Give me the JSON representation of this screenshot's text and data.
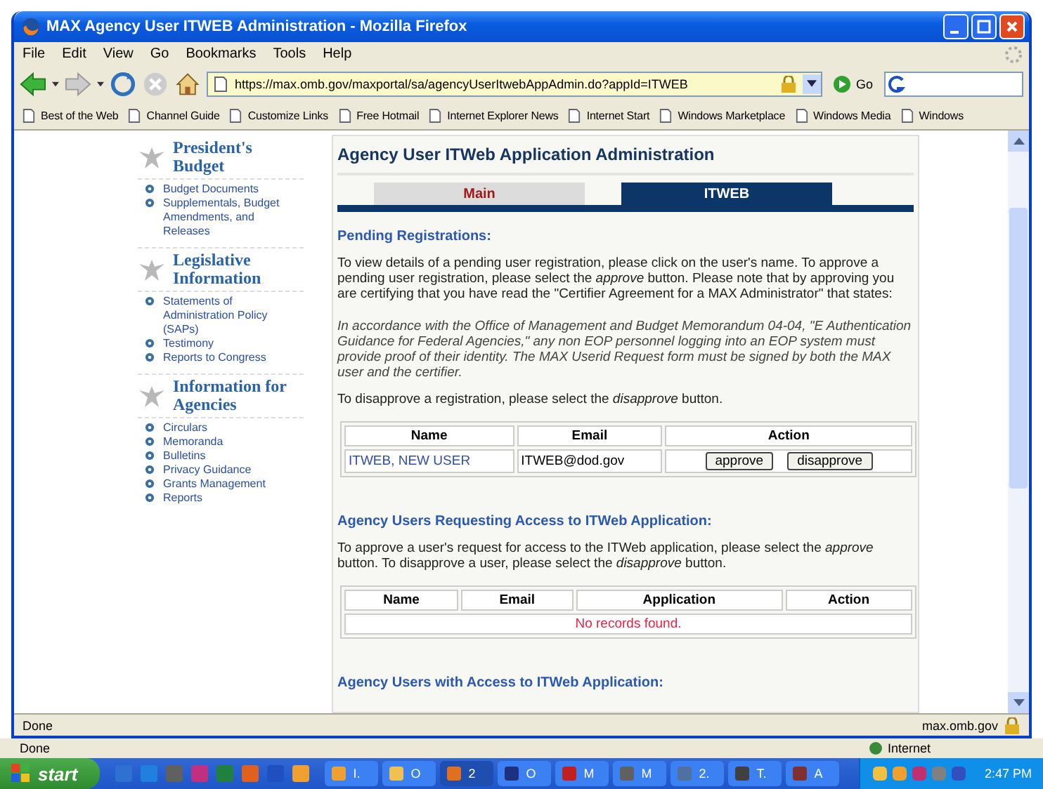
{
  "window": {
    "title": "MAX Agency User ITWEB Administration - Mozilla Firefox"
  },
  "menu": [
    "File",
    "Edit",
    "View",
    "Go",
    "Bookmarks",
    "Tools",
    "Help"
  ],
  "address": {
    "url": "https://max.omb.gov/maxportal/sa/agencyUserItwebAppAdmin.do?appId=ITWEB",
    "go": "Go"
  },
  "bookmarks": [
    "Best of the Web",
    "Channel Guide",
    "Customize Links",
    "Free Hotmail",
    "Internet Explorer News",
    "Internet Start",
    "Windows Marketplace",
    "Windows Media",
    "Windows"
  ],
  "sidebar": {
    "sections": [
      {
        "title": "President's Budget",
        "links": [
          "Budget Documents",
          "Supplementals, Budget Amendments, and Releases"
        ]
      },
      {
        "title": "Legislative Information",
        "links": [
          "Statements of Administration Policy (SAPs)",
          "Testimony",
          "Reports to Congress"
        ]
      },
      {
        "title": "Information for Agencies",
        "links": [
          "Circulars",
          "Memoranda",
          "Bulletins",
          "Privacy Guidance",
          "Grants Management",
          "Reports"
        ]
      }
    ]
  },
  "main": {
    "heading": "Agency User ITWeb Application Administration",
    "tabs": [
      {
        "label": "Main",
        "selected": false
      },
      {
        "label": "ITWEB",
        "selected": true
      }
    ],
    "pending": {
      "heading": "Pending Registrations:",
      "paragraphs": [
        {
          "kind": "plain",
          "text": "To view details of a pending user registration, please click on the user's name. To approve a pending user registration, please select the *approve* button. Please note that by approving you are certifying that you have read the \"Certifier Agreement for a MAX Administrator\" that states:"
        },
        {
          "kind": "quote",
          "text": "In accordance with the Office of Management and Budget Memorandum 04-04, \"E Authentication Guidance for Federal Agencies,\" any non EOP personnel logging into an EOP system must provide proof of their identity. The MAX Userid Request form must be signed by both the MAX user and the certifier."
        },
        {
          "kind": "plain",
          "text": "To disapprove a registration, please select the *disapprove* button."
        }
      ],
      "columns": [
        "Name",
        "Email",
        "Action"
      ],
      "rows": [
        {
          "name": "ITWEB, NEW USER",
          "email": "ITWEB@dod.gov",
          "actions": [
            "approve",
            "disapprove"
          ]
        }
      ]
    },
    "requesting": {
      "heading": "Agency Users Requesting Access to ITWeb Application:",
      "paragraphs": [
        {
          "kind": "plain",
          "text": "To approve a user's request for access to the ITWeb application, please select the *approve* button. To disapprove a user, please select the *disapprove* button."
        }
      ],
      "columns": [
        "Name",
        "Email",
        "Application",
        "Action"
      ],
      "empty_message": "No records found."
    },
    "with_access": {
      "heading": "Agency Users with Access to ITWeb Application:"
    }
  },
  "status_bar": {
    "text": "Done",
    "domain": "max.omb.gov"
  },
  "background_window": {
    "status": "Done",
    "zone": "Internet"
  },
  "taskbar": {
    "start": "start",
    "tasks": [
      {
        "label": "I.",
        "selected": false
      },
      {
        "label": "O",
        "selected": false
      },
      {
        "label": "2",
        "selected": true
      },
      {
        "label": "O",
        "selected": false
      },
      {
        "label": "M",
        "selected": false
      },
      {
        "label": "M",
        "selected": false
      },
      {
        "label": "2.",
        "selected": false
      },
      {
        "label": "T.",
        "selected": false
      },
      {
        "label": "A",
        "selected": false
      }
    ],
    "clock": "2:47 PM"
  }
}
